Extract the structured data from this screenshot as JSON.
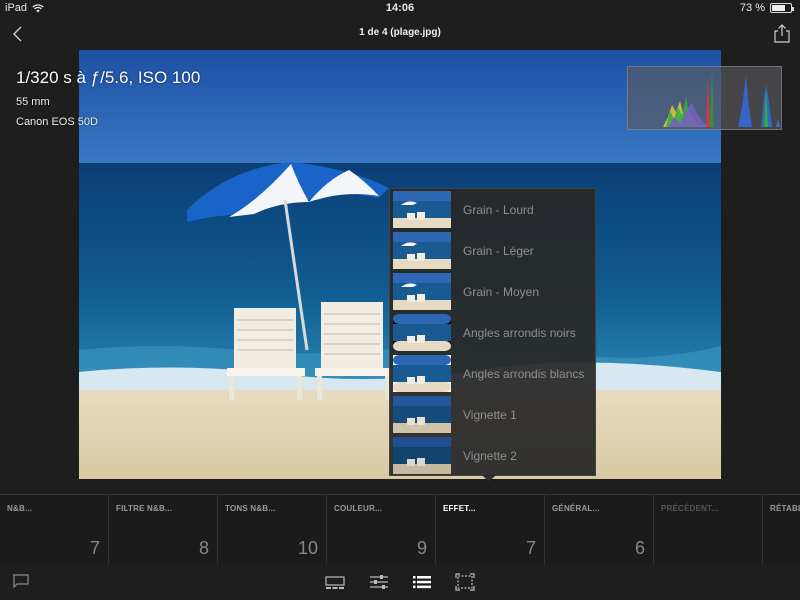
{
  "status_bar": {
    "device": "iPad",
    "time": "14:06",
    "battery": "73 %",
    "battery_level": 0.73
  },
  "header": {
    "title": "1 de 4 (plage.jpg)",
    "back_icon": "chevron-left-icon",
    "share_icon": "share-icon"
  },
  "photo_info": {
    "exposure": "1/320 s à ƒ/5.6, ISO 100",
    "focal_length": "55 mm",
    "camera": "Canon EOS 50D"
  },
  "presets": {
    "items": [
      {
        "label": "Grain - Lourd"
      },
      {
        "label": "Grain - Léger"
      },
      {
        "label": "Grain - Moyen"
      },
      {
        "label": "Angles arrondis noirs"
      },
      {
        "label": "Angles arrondis blancs"
      },
      {
        "label": "Vignette 1"
      },
      {
        "label": "Vignette 2"
      }
    ]
  },
  "categories": [
    {
      "name": "N&B...",
      "count": "7",
      "state": "normal"
    },
    {
      "name": "FILTRE N&B...",
      "count": "8",
      "state": "normal"
    },
    {
      "name": "TONS N&B...",
      "count": "10",
      "state": "normal"
    },
    {
      "name": "COULEUR...",
      "count": "9",
      "state": "normal"
    },
    {
      "name": "EFFET...",
      "count": "7",
      "state": "active"
    },
    {
      "name": "GÉNÉRAL...",
      "count": "6",
      "state": "normal"
    },
    {
      "name": "PRÉCÉDENT...",
      "count": "",
      "state": "disabled"
    },
    {
      "name": "RÉTABL",
      "count": "",
      "state": "normal"
    }
  ],
  "toolbar": {
    "icons": [
      "flag-icon",
      "filmstrip-icon",
      "adjust-sliders-icon",
      "presets-list-icon",
      "crop-icon"
    ]
  },
  "colors": {
    "background": "#1e1e1e",
    "panel": "#282828",
    "text_muted": "#8f8f8f"
  }
}
